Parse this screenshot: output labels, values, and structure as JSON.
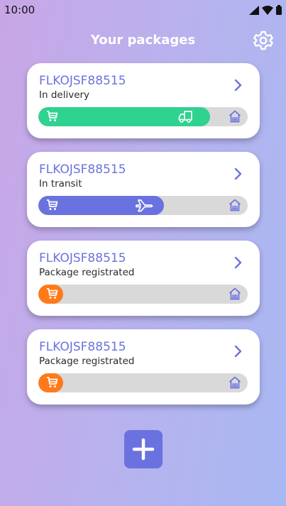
{
  "status_bar": {
    "time": "10:00"
  },
  "header": {
    "title": "Your packages"
  },
  "colors": {
    "accent": "#6a72df",
    "delivery": "#2fd28f",
    "transit": "#6a72df",
    "registered": "#ff7a1a",
    "track": "#d9d9d9"
  },
  "packages": [
    {
      "id": "FLKOJSF88515",
      "status": "In delivery",
      "progress": 0.82,
      "vehicle_icon": "truck-icon"
    },
    {
      "id": "FLKOJSF88515",
      "status": "In transit",
      "progress": 0.6,
      "vehicle_icon": "plane-icon"
    },
    {
      "id": "FLKOJSF88515",
      "status": "Package registrated",
      "progress": 0.12,
      "vehicle_icon": null
    },
    {
      "id": "FLKOJSF88515",
      "status": "Package registrated",
      "progress": 0.12,
      "vehicle_icon": null
    }
  ],
  "fab": {
    "icon": "plus-icon"
  }
}
